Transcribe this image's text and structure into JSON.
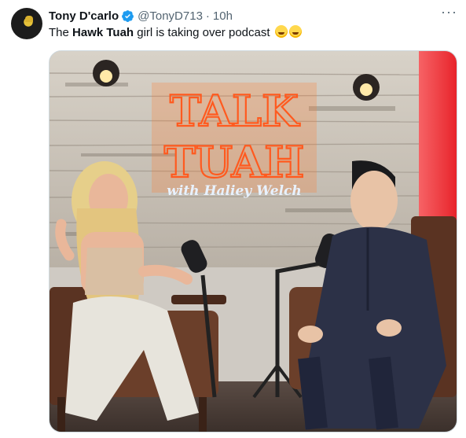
{
  "author": {
    "name": "Tony D'carlo",
    "handle": "@TonyD713",
    "separator": "·",
    "time": "10h"
  },
  "tweet": {
    "text_before": "The ",
    "bold": "Hawk Tuah",
    "text_after": " girl is taking over podcast"
  },
  "media": {
    "sign_line1": "TALK",
    "sign_line2": "TUAH",
    "sign_script": "with Haliey Welch"
  },
  "icons": {
    "verified": "verified-badge-icon",
    "more": "more-options-icon",
    "emoji": "face-with-tears-of-joy"
  },
  "colors": {
    "verified": "#1d9bf0",
    "text": "#0f1419",
    "secondary": "#536471",
    "neon": "#ff5a1f"
  }
}
